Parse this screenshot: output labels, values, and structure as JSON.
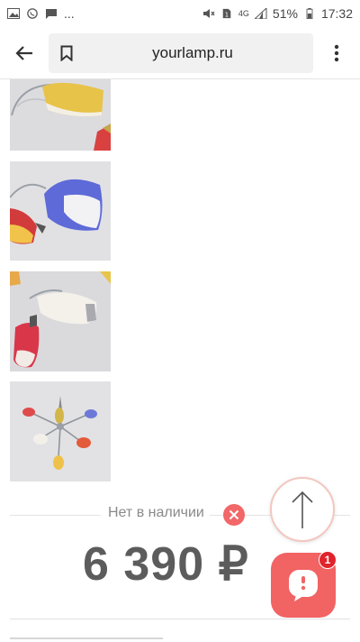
{
  "status_bar": {
    "left_more": "...",
    "signal_label": "4G",
    "battery": "51%",
    "time": "17:32"
  },
  "browser": {
    "url": "yourlamp.ru",
    "icons": [
      "back-arrow-icon",
      "bookmark-icon",
      "more-vert-icon"
    ]
  },
  "product": {
    "availability": "Нет в наличии",
    "price": "6 390 ₽"
  },
  "chat": {
    "badge_count": "1"
  },
  "colors": {
    "accent": "#f26363",
    "badge": "#e0232c",
    "price_text": "#5c5c5c",
    "muted_text": "#8a8a8a"
  }
}
